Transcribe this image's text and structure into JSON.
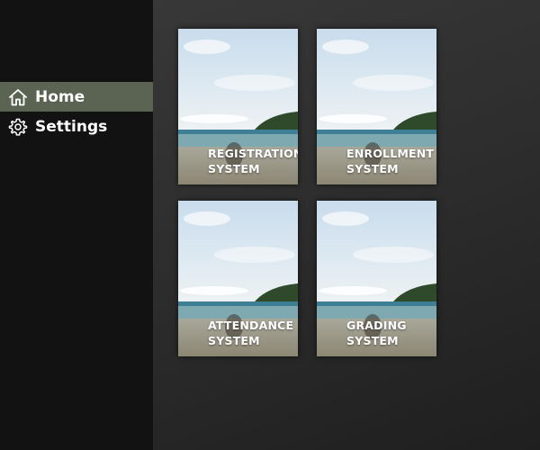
{
  "sidebar": {
    "items": [
      {
        "label": "Home",
        "icon": "home-icon",
        "active": true
      },
      {
        "label": "Settings",
        "icon": "gear-icon",
        "active": false
      }
    ]
  },
  "tiles": [
    {
      "line1": "REGISTRATION",
      "line2": "SYSTEM"
    },
    {
      "line1": "ENROLLMENT",
      "line2": "SYSTEM"
    },
    {
      "line1": "ATTENDANCE",
      "line2": "SYSTEM"
    },
    {
      "line1": "GRADING",
      "line2": "SYSTEM"
    }
  ],
  "colors": {
    "sidebar_bg": "#121212",
    "active_item_bg": "#5b6353",
    "main_bg": "#333333",
    "text": "#ffffff"
  }
}
